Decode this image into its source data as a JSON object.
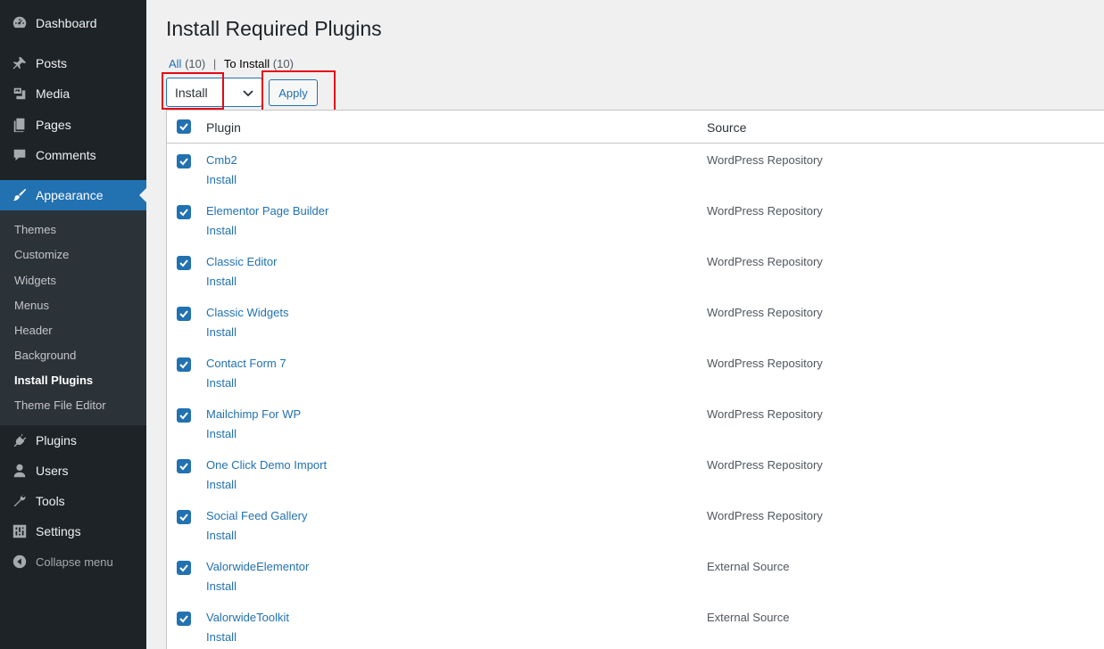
{
  "sidebar": {
    "top_items": [
      {
        "label": "Dashboard",
        "icon": "dashboard-icon"
      },
      {
        "label": "Posts",
        "icon": "pin-icon"
      },
      {
        "label": "Media",
        "icon": "media-icon"
      },
      {
        "label": "Pages",
        "icon": "pages-icon"
      },
      {
        "label": "Comments",
        "icon": "comments-icon"
      },
      {
        "label": "Appearance",
        "icon": "brush-icon"
      }
    ],
    "submenu": [
      "Themes",
      "Customize",
      "Widgets",
      "Menus",
      "Header",
      "Background",
      "Install Plugins",
      "Theme File Editor"
    ],
    "bottom_items": [
      {
        "label": "Plugins",
        "icon": "plugin-icon"
      },
      {
        "label": "Users",
        "icon": "users-icon"
      },
      {
        "label": "Tools",
        "icon": "wrench-icon"
      },
      {
        "label": "Settings",
        "icon": "settings-icon"
      }
    ],
    "collapse_label": "Collapse menu"
  },
  "page": {
    "title": "Install Required Plugins",
    "filters": {
      "all_label": "All",
      "all_count": "(10)",
      "separator": "|",
      "to_install_label": "To Install",
      "to_install_count": "(10)"
    },
    "bulk_action": {
      "selected": "Install",
      "apply_label": "Apply"
    }
  },
  "table": {
    "columns": [
      "Plugin",
      "Source"
    ],
    "rows": [
      {
        "name": "Cmb2",
        "action": "Install",
        "source": "WordPress Repository"
      },
      {
        "name": "Elementor Page Builder",
        "action": "Install",
        "source": "WordPress Repository"
      },
      {
        "name": "Classic Editor",
        "action": "Install",
        "source": "WordPress Repository"
      },
      {
        "name": "Classic Widgets",
        "action": "Install",
        "source": "WordPress Repository"
      },
      {
        "name": "Contact Form 7",
        "action": "Install",
        "source": "WordPress Repository"
      },
      {
        "name": "Mailchimp For WP",
        "action": "Install",
        "source": "WordPress Repository"
      },
      {
        "name": "One Click Demo Import",
        "action": "Install",
        "source": "WordPress Repository"
      },
      {
        "name": "Social Feed Gallery",
        "action": "Install",
        "source": "WordPress Repository"
      },
      {
        "name": "ValorwideElementor",
        "action": "Install",
        "source": "External Source"
      },
      {
        "name": "ValorwideToolkit",
        "action": "Install",
        "source": "External Source"
      }
    ]
  },
  "colors": {
    "sidebar": "#1d2327",
    "submenu": "#2c3338",
    "accent": "#2271b1",
    "highlight": "#e50914"
  }
}
